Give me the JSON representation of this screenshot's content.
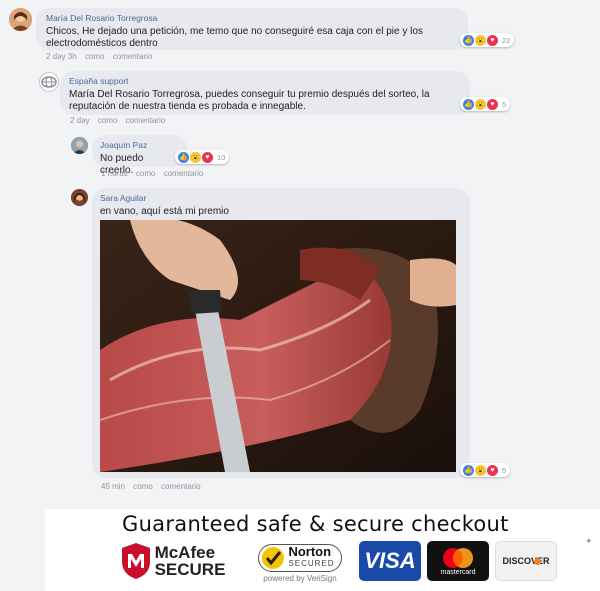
{
  "comments": [
    {
      "author": "María Del Rosario Torregrosa",
      "text": "Chicos, He dejado una petición, me temo que no conseguiré esa caja con el pie y los electrodomésticos dentro",
      "time": "2 day 3h",
      "like_label": "como",
      "reply_label": "comentario",
      "reaction_count": "22"
    },
    {
      "author": "España support",
      "text": "María Del Rosario Torregrosa, puedes conseguir tu premio después del sorteo, la reputación de nuestra tienda es probada e innegable.",
      "time": "2 day",
      "like_label": "como",
      "reply_label": "comentario",
      "reaction_count": "5"
    },
    {
      "author": "Joaquín Paz",
      "text": "No puedo creerlo.",
      "time": "1 horas",
      "like_label": "como",
      "reply_label": "comentario",
      "reaction_count": "10"
    },
    {
      "author": "Sara Aguilar",
      "text": "en vano, aquí está mi premio",
      "time": "45 min",
      "like_label": "como",
      "reply_label": "comentario",
      "reaction_count": "5"
    }
  ],
  "trust": {
    "title": "Guaranteed safe & secure checkout",
    "mcafee_top": "McAfee",
    "mcafee_bottom": "SECURE",
    "norton_top": "Norton",
    "norton_bottom": "SECURED",
    "norton_powered": "powered by VeriSign",
    "visa": "VISA",
    "mastercard": "mastercard",
    "discover": "DISCOVER"
  },
  "colors": {
    "bubble": "#e7e9ee",
    "author": "#4b67a1",
    "like": "#3b7ff0",
    "love": "#e8354d",
    "wow": "#f7c531"
  }
}
